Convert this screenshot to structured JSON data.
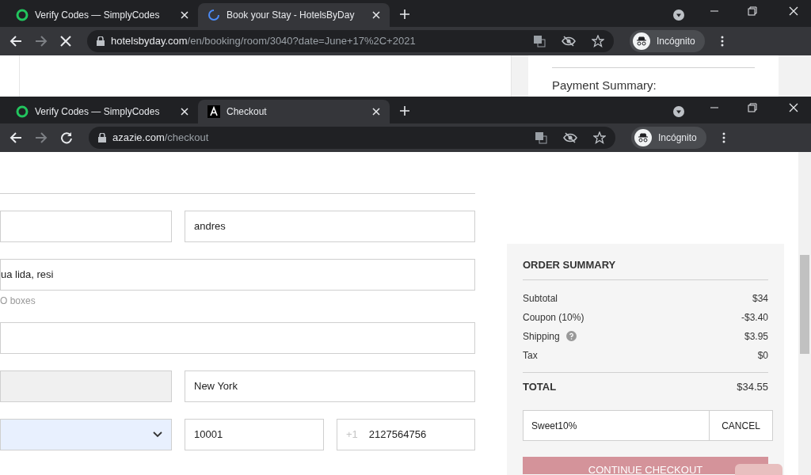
{
  "windows": [
    {
      "tabs": [
        {
          "title": "Verify Codes — SimplyCodes",
          "selected": false
        },
        {
          "title": "Book your Stay - HotelsByDay",
          "selected": true
        }
      ],
      "address": {
        "host": "hotelsbyday.com",
        "path": "/en/booking/room/3040?date=June+17%2C+2021"
      },
      "loading": true,
      "profile": "Incógnito",
      "page": {
        "heading": "Payment Summary:"
      }
    },
    {
      "tabs": [
        {
          "title": "Verify Codes — SimplyCodes",
          "selected": false
        },
        {
          "title": "Checkout",
          "selected": true
        }
      ],
      "address": {
        "host": "azazie.com",
        "path": "/checkout"
      },
      "loading": false,
      "profile": "Incógnito"
    }
  ],
  "form": {
    "rows": [
      [
        {
          "disabled": false
        },
        {
          "value": "andres",
          "disabled": false
        }
      ],
      [
        {
          "value": "ua lida, resi",
          "disabled": false
        }
      ],
      [
        {
          "disabled": false
        }
      ],
      [
        {
          "disabled": true
        },
        {
          "value": "New York",
          "disabled": false
        }
      ],
      [
        {
          "kind": "select",
          "autofilled": true
        },
        {
          "value": "10001",
          "disabled": false
        },
        {
          "value": "2127564756",
          "prefix": "+1",
          "disabled": false
        }
      ]
    ],
    "hint": "O boxes"
  },
  "order_summary": {
    "title": "ORDER SUMMARY",
    "lines": [
      {
        "label": "Subtotal",
        "amount": "$34",
        "help": false
      },
      {
        "label": "Coupon (10%)",
        "amount": "-$3.40",
        "help": false
      },
      {
        "label": "Shipping",
        "amount": "$3.95",
        "help": true
      },
      {
        "label": "Tax",
        "amount": "$0",
        "help": false
      }
    ],
    "total": {
      "label": "TOTAL",
      "amount": "$34.55"
    },
    "coupon": {
      "value": "Sweet10%",
      "button": "CANCEL"
    },
    "checkout_button": "CONTINUE CHECKOUT"
  }
}
